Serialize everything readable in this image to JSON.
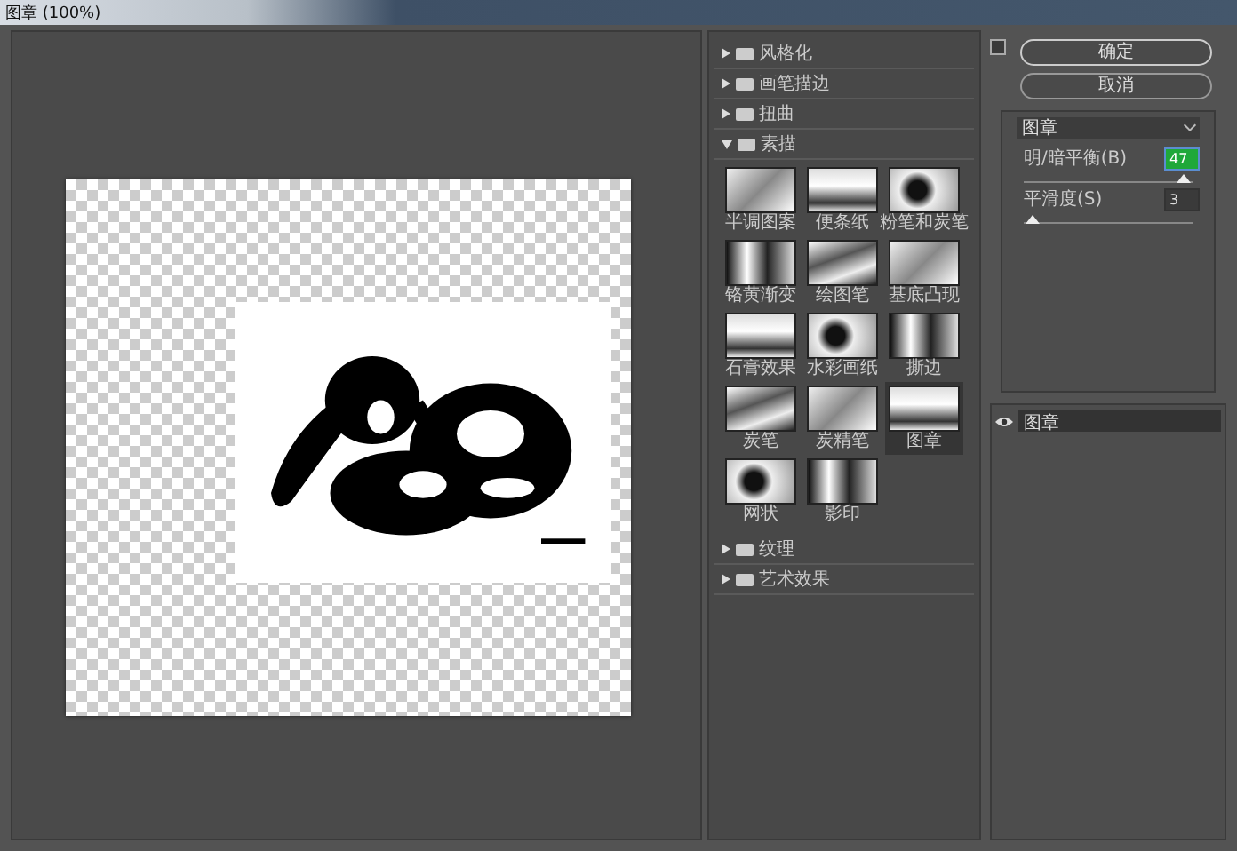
{
  "window": {
    "title": "图章 (100%)"
  },
  "categories": [
    {
      "label": "风格化",
      "expanded": false
    },
    {
      "label": "画笔描边",
      "expanded": false
    },
    {
      "label": "扭曲",
      "expanded": false
    },
    {
      "label": "素描",
      "expanded": true,
      "filters": [
        {
          "label": "半调图案",
          "selected": false
        },
        {
          "label": "便条纸",
          "selected": false
        },
        {
          "label": "粉笔和炭笔",
          "selected": false
        },
        {
          "label": "铬黄渐变",
          "selected": false
        },
        {
          "label": "绘图笔",
          "selected": false
        },
        {
          "label": "基底凸现",
          "selected": false
        },
        {
          "label": "石膏效果",
          "selected": false
        },
        {
          "label": "水彩画纸",
          "selected": false
        },
        {
          "label": "撕边",
          "selected": false
        },
        {
          "label": "炭笔",
          "selected": false
        },
        {
          "label": "炭精笔",
          "selected": false
        },
        {
          "label": "图章",
          "selected": true
        },
        {
          "label": "网状",
          "selected": false
        },
        {
          "label": "影印",
          "selected": false
        }
      ]
    },
    {
      "label": "纹理",
      "expanded": false
    },
    {
      "label": "艺术效果",
      "expanded": false
    }
  ],
  "buttons": [
    {
      "label": "确定",
      "default": true
    },
    {
      "label": "取消",
      "default": false
    }
  ],
  "filter_select": {
    "value": "图章"
  },
  "settings": [
    {
      "label": "明/暗平衡(B)",
      "value": "47",
      "focused": true,
      "level": 0.95
    },
    {
      "label": "平滑度(S)",
      "value": "3",
      "focused": false,
      "level": 0.05
    }
  ],
  "layers": [
    {
      "label": "图章",
      "visible": true
    }
  ]
}
